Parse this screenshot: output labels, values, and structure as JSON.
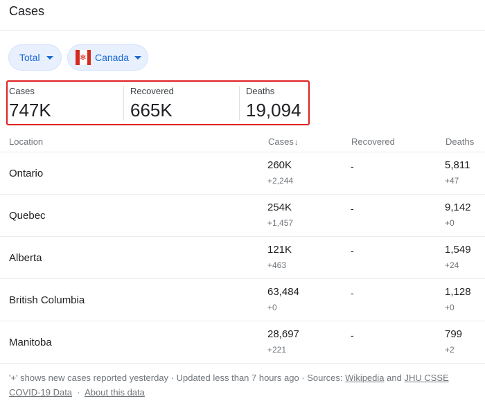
{
  "header": {
    "title": "Cases"
  },
  "filters": {
    "metric": "Total",
    "country": "Canada"
  },
  "summary": [
    {
      "label": "Cases",
      "value": "747K"
    },
    {
      "label": "Recovered",
      "value": "665K"
    },
    {
      "label": "Deaths",
      "value": "19,094"
    }
  ],
  "table": {
    "headers": {
      "location": "Location",
      "cases": "Cases",
      "recovered": "Recovered",
      "deaths": "Deaths"
    },
    "sort_arrow": "↓",
    "rows": [
      {
        "location": "Ontario",
        "cases": "260K",
        "cases_new": "+2,244",
        "recovered": "-",
        "deaths": "5,811",
        "deaths_new": "+47"
      },
      {
        "location": "Quebec",
        "cases": "254K",
        "cases_new": "+1,457",
        "recovered": "-",
        "deaths": "9,142",
        "deaths_new": "+0"
      },
      {
        "location": "Alberta",
        "cases": "121K",
        "cases_new": "+463",
        "recovered": "-",
        "deaths": "1,549",
        "deaths_new": "+24"
      },
      {
        "location": "British Columbia",
        "cases": "63,484",
        "cases_new": "+0",
        "recovered": "-",
        "deaths": "1,128",
        "deaths_new": "+0"
      },
      {
        "location": "Manitoba",
        "cases": "28,697",
        "cases_new": "+221",
        "recovered": "-",
        "deaths": "799",
        "deaths_new": "+2"
      }
    ]
  },
  "footer": {
    "note": "'+' shows new cases reported yesterday · Updated less than 7 hours ago · Sources:",
    "source1": "Wikipedia",
    "and": "and",
    "source2": "JHU CSSE COVID-19 Data",
    "sep": "·",
    "about": "About this data"
  },
  "colors": {
    "chip_bg": "#e8f0fe",
    "chip_text": "#1967d2",
    "highlight_border": "#e02020",
    "flag_red": "#d52b1e"
  }
}
